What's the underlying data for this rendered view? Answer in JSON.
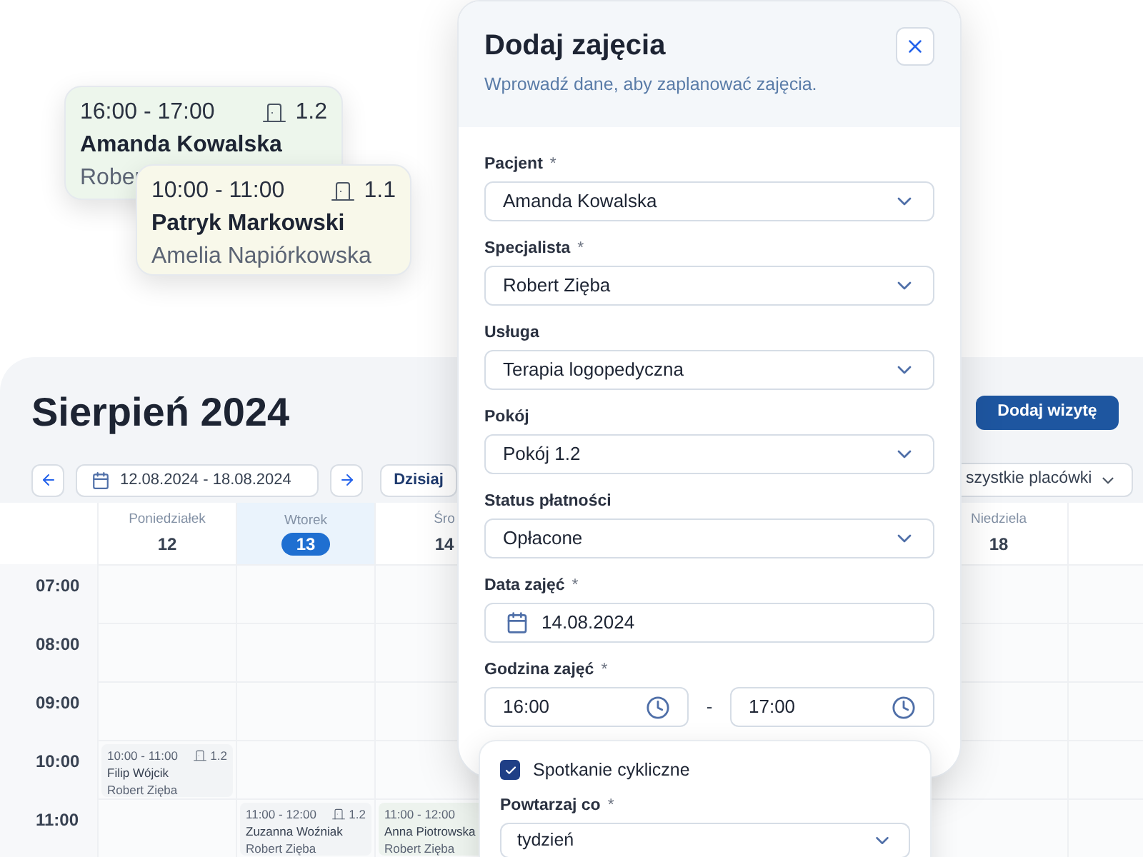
{
  "floating_cards": [
    {
      "time": "16:00 - 17:00",
      "room": "1.2",
      "patient": "Amanda Kowalska",
      "specialist": "Rober",
      "color": "#edf6ec"
    },
    {
      "time": "10:00 - 11:00",
      "room": "1.1",
      "patient": "Patryk Markowski",
      "specialist": "Amelia Napiórkowska",
      "color": "#f8f8ea"
    }
  ],
  "calendar": {
    "title": "Sierpień 2024",
    "add_button": "Dodaj wizytę",
    "date_range": "12.08.2024 - 18.08.2024",
    "today_button": "Dzisiaj",
    "location_select": "szystkie placówki",
    "days": [
      {
        "label": "Poniedziałek",
        "date": "12",
        "selected": false
      },
      {
        "label": "Wtorek",
        "date": "13",
        "selected": true
      },
      {
        "label": "Śro",
        "date": "14",
        "selected": false
      },
      {
        "label": "Niedziela",
        "date": "18",
        "selected": false
      }
    ],
    "hours": [
      {
        "label": "07:00"
      },
      {
        "label": "08:00"
      },
      {
        "label": "09:00"
      },
      {
        "label": "10:00",
        "cells": [
          {
            "kind": "event",
            "time": "10:00 - 11:00",
            "room": "1.2",
            "patient": "Filip Wójcik",
            "specialist": "Robert Zięba",
            "color": "#f2f4f6"
          }
        ]
      },
      {
        "label": "11:00",
        "cells": [
          {
            "kind": "empty"
          },
          {
            "kind": "event",
            "time": "11:00 - 12:00",
            "room": "1.2",
            "patient": "Zuzanna Woźniak",
            "specialist": "Robert Zięba",
            "color": "#f2f4f6"
          },
          {
            "kind": "event",
            "time": "11:00 - 12:00",
            "patient": "Anna Piotrowska",
            "specialist": "Robert Zięba",
            "color": "#edf3ee"
          }
        ]
      }
    ]
  },
  "modal": {
    "title": "Dodaj zajęcia",
    "subtitle": "Wprowadź dane, aby zaplanować zajęcia.",
    "fields": [
      {
        "kind": "select",
        "label": "Pacjent",
        "asterisk": "*",
        "value": "Amanda Kowalska"
      },
      {
        "kind": "select",
        "label": "Specjalista",
        "asterisk": "*",
        "value": "Robert Zięba"
      },
      {
        "kind": "select",
        "label": "Usługa",
        "value": "Terapia logopedyczna"
      },
      {
        "kind": "select",
        "label": "Pokój",
        "value": "Pokój 1.2"
      },
      {
        "kind": "select",
        "label": "Status płatności",
        "value": "Opłacone"
      },
      {
        "kind": "date",
        "label": "Data zajęć",
        "asterisk": "*",
        "value": "14.08.2024"
      },
      {
        "kind": "time_range",
        "label": "Godzina zajęć",
        "asterisk": "*",
        "from": "16:00",
        "separator": "-",
        "to": "17:00"
      }
    ]
  },
  "recurring": {
    "label": "Spotkanie cykliczne",
    "checked": true,
    "repeat_label": "Powtarzaj co",
    "asterisk": "*",
    "repeat_value": "tydzień"
  }
}
